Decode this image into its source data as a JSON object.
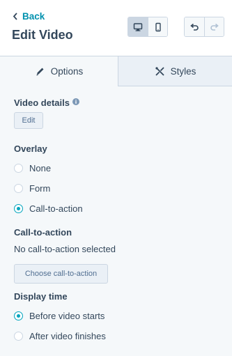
{
  "header": {
    "back_label": "Back",
    "title": "Edit Video",
    "device_buttons": [
      {
        "icon": "desktop-icon",
        "active": true
      },
      {
        "icon": "mobile-icon",
        "active": false
      }
    ],
    "history_buttons": [
      {
        "icon": "undo-icon"
      },
      {
        "icon": "redo-icon"
      }
    ]
  },
  "tabs": [
    {
      "label": "Options",
      "icon": "pencil-icon",
      "active": true
    },
    {
      "label": "Styles",
      "icon": "styles-icon",
      "active": false
    }
  ],
  "video_details": {
    "label": "Video details",
    "edit_button": "Edit"
  },
  "overlay": {
    "label": "Overlay",
    "options": [
      "None",
      "Form",
      "Call-to-action"
    ],
    "selected": "Call-to-action"
  },
  "cta": {
    "label": "Call-to-action",
    "status": "No call-to-action selected",
    "choose_button": "Choose call-to-action"
  },
  "display_time": {
    "label": "Display time",
    "options": [
      "Before video starts",
      "After video finishes"
    ],
    "selected": "Before video starts"
  },
  "colors": {
    "accent": "#00a4bd",
    "link": "#0091ae",
    "text": "#33475b",
    "border": "#cbd6e2",
    "background": "#f5f8fa"
  }
}
